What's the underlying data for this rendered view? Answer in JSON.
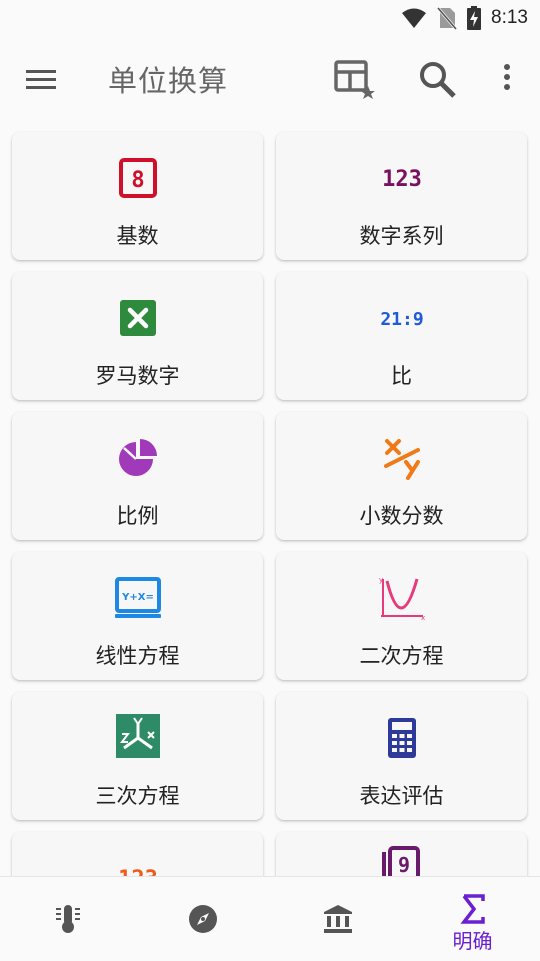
{
  "status": {
    "time": "8:13"
  },
  "app_bar": {
    "title": "单位换算"
  },
  "cards": [
    {
      "label": "基数",
      "icon": "base-icon",
      "glyph": "8"
    },
    {
      "label": "数字系列",
      "icon": "number-series-icon",
      "glyph": "123"
    },
    {
      "label": "罗马数字",
      "icon": "roman-numeral-icon",
      "glyph": "✕"
    },
    {
      "label": "比",
      "icon": "ratio-icon",
      "glyph": "21:9"
    },
    {
      "label": "比例",
      "icon": "proportion-icon"
    },
    {
      "label": "小数分数",
      "icon": "fraction-icon"
    },
    {
      "label": "线性方程",
      "icon": "linear-equation-icon",
      "glyph": "Y+X="
    },
    {
      "label": "二次方程",
      "icon": "quadratic-equation-icon"
    },
    {
      "label": "三次方程",
      "icon": "cubic-equation-icon"
    },
    {
      "label": "表达评估",
      "icon": "calculator-icon"
    }
  ],
  "partial_cards": [
    {
      "glyph": "123",
      "icon": "numeral-system-icon"
    },
    {
      "glyph": "9",
      "icon": "digit-icon"
    }
  ],
  "bottom_nav": {
    "active_label": "明确"
  }
}
